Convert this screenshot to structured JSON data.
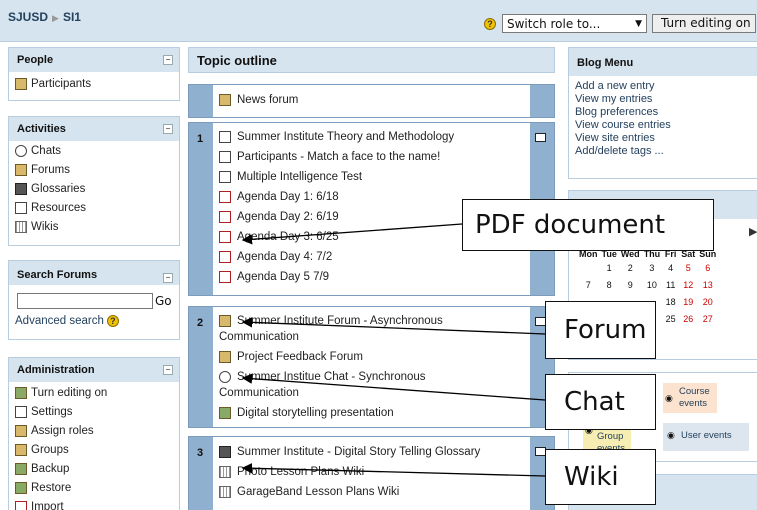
{
  "breadcrumb": {
    "site": "SJUSD",
    "course": "SI1"
  },
  "header": {
    "switch_role_label": "Switch role to...",
    "turn_editing_label": "Turn editing on",
    "help_glyph": "?"
  },
  "left": {
    "people": {
      "title": "People",
      "items": [
        "Participants"
      ]
    },
    "activities": {
      "title": "Activities",
      "items": [
        "Chats",
        "Forums",
        "Glossaries",
        "Resources",
        "Wikis"
      ]
    },
    "search": {
      "title": "Search Forums",
      "go_label": "Go",
      "advanced_label": "Advanced search"
    },
    "admin": {
      "title": "Administration",
      "items": [
        "Turn editing on",
        "Settings",
        "Assign roles",
        "Groups",
        "Backup",
        "Restore",
        "Import"
      ]
    }
  },
  "center": {
    "title": "Topic outline",
    "section0": {
      "items": [
        "News forum"
      ]
    },
    "section1": {
      "number": "1",
      "items": [
        "Summer Institute Theory and Methodology",
        "Participants - Match a face to the name!",
        "Multiple Intelligence Test",
        "Agenda Day 1: 6/18",
        "Agenda Day 2: 6/19",
        "Agenda Day 3: 6/25",
        "Agenda Day 4: 7/2",
        "Agenda Day 5 7/9"
      ]
    },
    "section2": {
      "number": "2",
      "items": [
        "Summer Institute Forum - Asynchronous",
        "Communication",
        "Project Feedback Forum",
        "Summer Institue Chat - Synchronous",
        "Communication",
        "Digital storytelling presentation"
      ]
    },
    "section3": {
      "number": "3",
      "items": [
        "Summer Institute - Digital Story Telling Glossary",
        "Photo Lesson Plans Wiki",
        "GarageBand Lesson Plans Wiki"
      ]
    }
  },
  "right": {
    "blog": {
      "title": "Blog Menu",
      "items": [
        "Add a new entry",
        "View my entries",
        "Blog preferences",
        "View course entries",
        "View site entries",
        "Add/delete tags ..."
      ]
    },
    "calendar": {
      "days": [
        "Mon",
        "Tue",
        "Wed",
        "Thu",
        "Fri",
        "Sat",
        "Sun"
      ],
      "weeks": [
        [
          "",
          "1",
          "2",
          "3",
          "4",
          "5",
          "6"
        ],
        [
          "7",
          "8",
          "9",
          "10",
          "11",
          "12",
          "13"
        ],
        [
          "",
          "",
          "",
          "",
          "18",
          "19",
          "20"
        ],
        [
          "",
          "",
          "",
          "",
          "25",
          "26",
          "27"
        ]
      ],
      "next_glyph": "▶"
    },
    "legend": {
      "course_events": "Course events",
      "group_events": "Group events",
      "user_events": "User events"
    }
  },
  "callouts": {
    "pdf": "PDF document",
    "forum": "Forum",
    "chat": "Chat",
    "wiki": "Wiki"
  }
}
